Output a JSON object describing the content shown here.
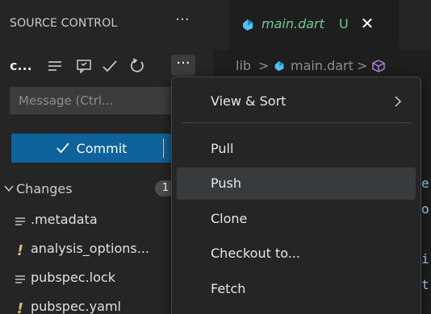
{
  "sidebar": {
    "title": "SOURCE CONTROL",
    "more_label": "···",
    "repo_name": "c...",
    "toolbar_more_label": "···",
    "message_placeholder": "Message (Ctrl...",
    "commit_label": "Commit",
    "changes_label": "Changes",
    "changes_count": "1",
    "files": [
      {
        "name": ".metadata",
        "icon": "lines-file-icon"
      },
      {
        "name": "analysis_options...",
        "icon": "exclamation-icon"
      },
      {
        "name": "pubspec.lock",
        "icon": "lines-file-icon"
      },
      {
        "name": "pubspec.yaml",
        "icon": "exclamation-icon"
      }
    ]
  },
  "tab": {
    "label": "main.dart",
    "status": "U",
    "close": "✕"
  },
  "breadcrumb": {
    "parts": [
      "lib",
      ">",
      "main.dart",
      ">"
    ]
  },
  "editor": {
    "peek_chars": [
      "e",
      "o",
      "i",
      "t"
    ]
  },
  "menu": {
    "items": [
      {
        "label": "View & Sort",
        "has_submenu": true
      },
      {
        "label": "Pull"
      },
      {
        "label": "Push"
      },
      {
        "label": "Clone"
      },
      {
        "label": "Checkout to..."
      },
      {
        "label": "Fetch"
      }
    ]
  },
  "colors": {
    "accent_button": "#0e639c",
    "untracked_green": "#73c991",
    "dart_icon": "#4fc3f7",
    "warning_yellow": "#d7ba7d"
  }
}
